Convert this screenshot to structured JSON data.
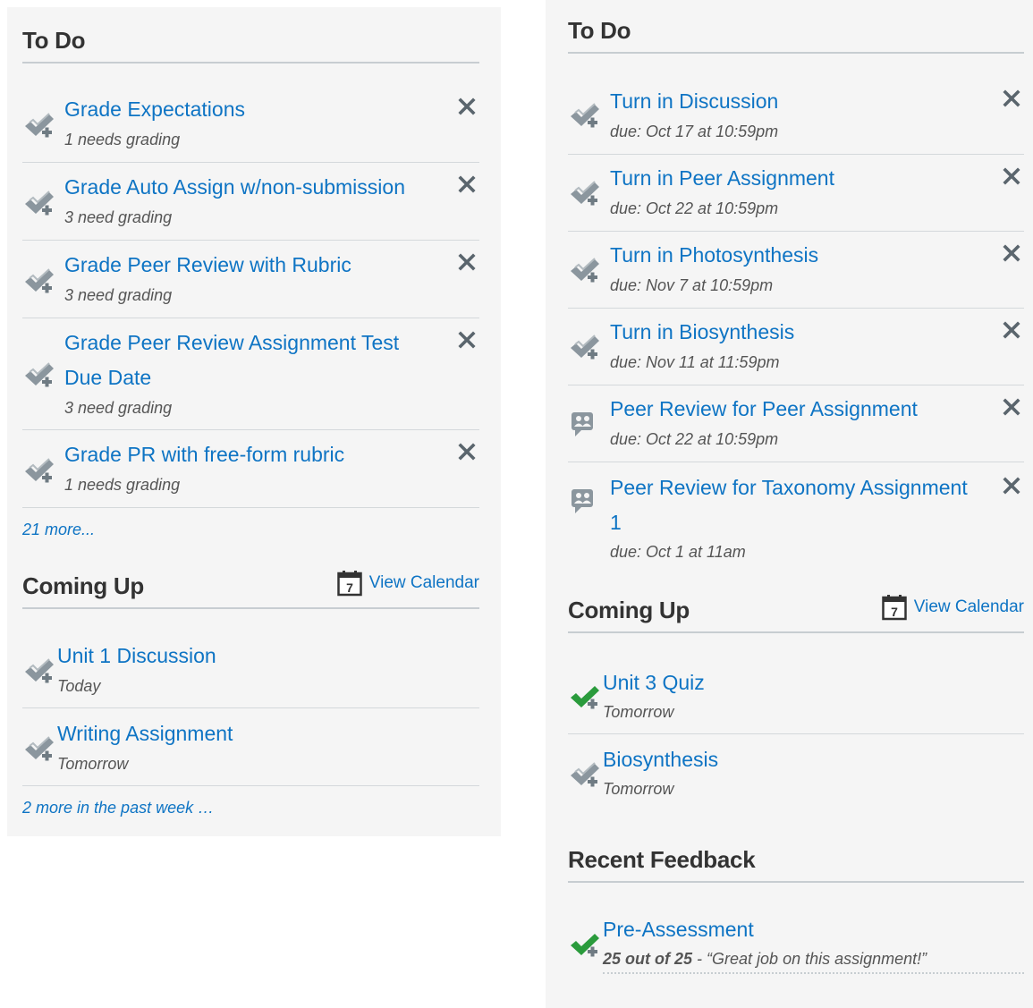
{
  "left": {
    "todo_title": "To Do",
    "todo": [
      {
        "title": "Grade Expectations",
        "sub": "1 needs grading"
      },
      {
        "title": "Grade Auto Assign w/non-submission",
        "sub": "3 need grading"
      },
      {
        "title": "Grade Peer Review with Rubric",
        "sub": "3 need grading"
      },
      {
        "title_line1": "Grade Peer Review Assignment Test",
        "title_line2": "Due Date",
        "sub": "3 need grading"
      },
      {
        "title": "Grade PR with free-form rubric",
        "sub": "1 needs grading"
      }
    ],
    "todo_more": "21 more...",
    "coming_title": "Coming Up",
    "view_calendar": "View Calendar",
    "calendar_day": "7",
    "coming": [
      {
        "title": "Unit 1 Discussion",
        "sub": "Today"
      },
      {
        "title": "Writing Assignment",
        "sub": "Tomorrow"
      }
    ],
    "coming_more": "2 more in the past week …"
  },
  "right": {
    "todo_title": "To Do",
    "todo": [
      {
        "title": "Turn in Discussion",
        "sub": "due: Oct 17 at 10:59pm",
        "icon": "assignment-check-icon"
      },
      {
        "title": "Turn in Peer Assignment",
        "sub": "due: Oct 22 at 10:59pm",
        "icon": "assignment-check-icon"
      },
      {
        "title": "Turn in Photosynthesis",
        "sub": "due: Nov 7 at 10:59pm",
        "icon": "assignment-check-icon"
      },
      {
        "title": "Turn in Biosynthesis",
        "sub": "due: Nov 11 at 11:59pm",
        "icon": "assignment-check-icon"
      },
      {
        "title": "Peer Review for Peer Assignment",
        "sub": "due: Oct 22 at 10:59pm",
        "icon": "peer-review-icon"
      },
      {
        "title_line1": "Peer Review for Taxonomy Assignment",
        "title_line2": "1",
        "sub": "due: Oct 1 at 11am",
        "icon": "peer-review-icon"
      }
    ],
    "coming_title": "Coming Up",
    "view_calendar": "View Calendar",
    "calendar_day": "7",
    "coming": [
      {
        "title": "Unit 3 Quiz",
        "sub": "Tomorrow",
        "icon": "completed-check-icon"
      },
      {
        "title": "Biosynthesis",
        "sub": "Tomorrow",
        "icon": "assignment-check-icon"
      }
    ],
    "feedback_title": "Recent Feedback",
    "feedback": {
      "title": "Pre-Assessment",
      "score": "25 out of 25",
      "separator": " - ",
      "comment": "“Great job on this assignment!”"
    }
  },
  "colors": {
    "link": "#0e74c4",
    "panel_bg": "#f5f5f5",
    "icon_gray": "#8b969e",
    "icon_green": "#2a9b3c",
    "close_gray": "#5a656d"
  }
}
